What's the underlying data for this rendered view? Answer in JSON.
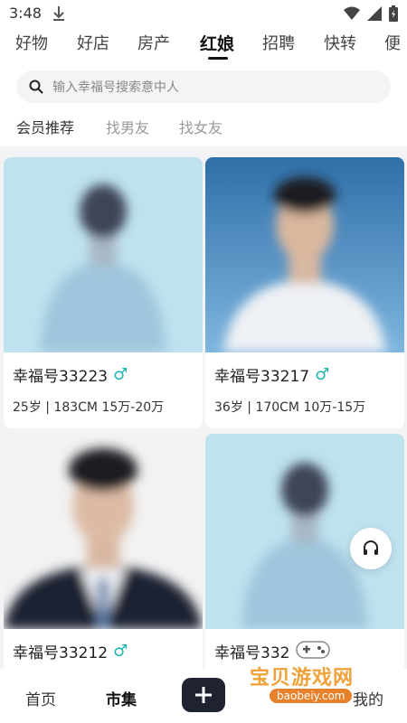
{
  "status_bar": {
    "time": "3:48"
  },
  "category_tabs": [
    {
      "label": "好物"
    },
    {
      "label": "好店"
    },
    {
      "label": "房产"
    },
    {
      "label": "红娘"
    },
    {
      "label": "招聘"
    },
    {
      "label": "快转"
    },
    {
      "label": "便"
    }
  ],
  "active_category": "红娘",
  "search": {
    "placeholder": "输入幸福号搜索意中人"
  },
  "sub_tabs": [
    {
      "label": "会员推荐"
    },
    {
      "label": "找男友"
    },
    {
      "label": "找女友"
    }
  ],
  "active_sub_tab": "会员推荐",
  "cards": [
    {
      "name": "幸福号33223",
      "gender": "♂",
      "meta": "25岁 | 183CM  15万-20万"
    },
    {
      "name": "幸福号33217",
      "gender": "♂",
      "meta": "36岁 | 170CM  10万-15万"
    },
    {
      "name": "幸福号33212",
      "gender": "♂",
      "meta": ""
    },
    {
      "name": "幸福号332",
      "gender": "♂",
      "meta": ""
    }
  ],
  "bottom_nav": {
    "home": "首页",
    "market": "市集",
    "mine": "我的"
  },
  "watermark": {
    "text": "宝贝游戏网",
    "url": "baobeiy.com"
  },
  "colors": {
    "accent": "#1fb5b0",
    "dark_button": "#1f2230",
    "watermark": "#f0a23a"
  }
}
